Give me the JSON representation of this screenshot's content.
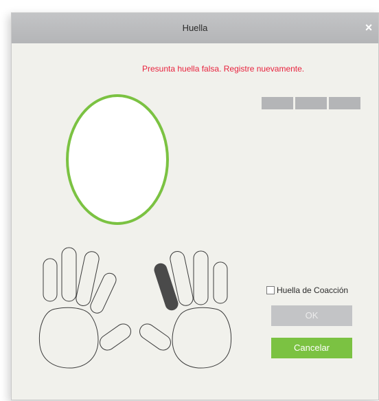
{
  "dialog": {
    "title": "Huella",
    "close_symbol": "×",
    "warning_message": "Presunta huella falsa. Registre nuevamente.",
    "duress_label": "Huella de Coacción",
    "duress_checked": false,
    "ok_label": "OK",
    "cancel_label": "Cancelar",
    "enrollment_progress": {
      "completed": 0,
      "total": 3
    },
    "selected_finger": "right-index"
  },
  "colors": {
    "warning": "#e8223d",
    "accent_green": "#7bc242",
    "titlebar": "#b4b5b7",
    "disabled_button": "#c3c4c6",
    "selected_finger": "#4a4a4a"
  }
}
